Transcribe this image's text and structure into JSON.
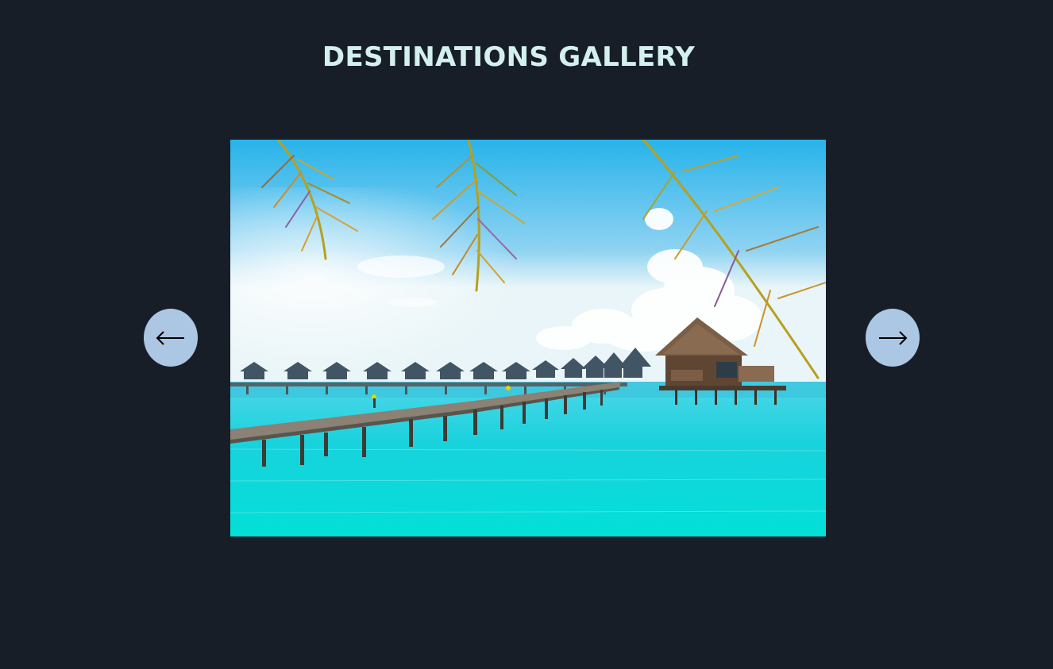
{
  "gallery": {
    "title": "DESTINATIONS GALLERY",
    "prev_label": "previous",
    "next_label": "next",
    "prev_icon": "arrow-left-icon",
    "next_icon": "arrow-right-icon"
  },
  "colors": {
    "background": "#181e28",
    "title": "#d3f0ee",
    "nav_button": "#abc7e3",
    "arrow": "#000000"
  }
}
